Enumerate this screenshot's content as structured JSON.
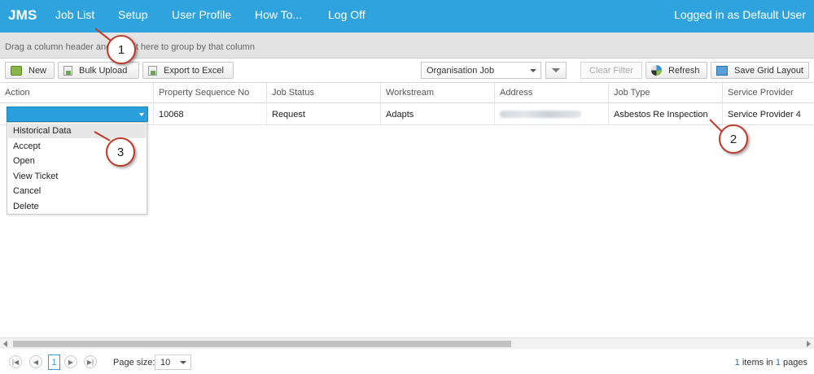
{
  "nav": {
    "brand": "JMS",
    "items": [
      "Job List",
      "Setup",
      "User Profile",
      "How To...",
      "Log Off"
    ],
    "user": "Logged in as Default User"
  },
  "groupbar": {
    "hint": "Drag a column header and drop it here to group by that column"
  },
  "toolbar": {
    "new": "New",
    "bulk_upload": "Bulk Upload",
    "export": "Export to Excel",
    "view_select": "Organisation Job",
    "clear_filter": "Clear Filter",
    "refresh": "Refresh",
    "save_layout": "Save Grid Layout"
  },
  "grid": {
    "columns": [
      "Action",
      "Property Sequence No",
      "Job Status",
      "Workstream",
      "Address",
      "Job Type",
      "Service Provider"
    ],
    "row": {
      "property_seq": "10068",
      "status": "Request",
      "workstream": "Adapts",
      "job_type": "Asbestos Re Inspection",
      "provider": "Service Provider 4"
    }
  },
  "action_menu": [
    "Historical Data",
    "Accept",
    "Open",
    "View Ticket",
    "Cancel",
    "Delete"
  ],
  "callouts": [
    "1",
    "2",
    "3"
  ],
  "pager": {
    "page": "1",
    "page_size_label": "Page size:",
    "page_size": "10",
    "info_count": "1",
    "info_mid": "items in",
    "info_pages": "1",
    "info_tail": "pages"
  },
  "colors": {
    "primary": "#2ea3dd",
    "callout": "#c0392b"
  }
}
